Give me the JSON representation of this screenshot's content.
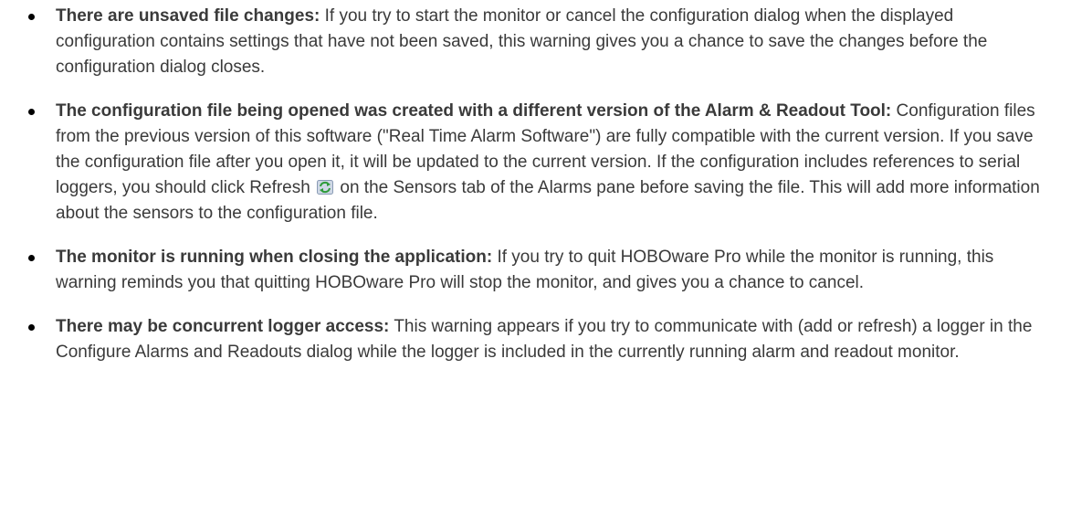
{
  "items": [
    {
      "term": "There are unsaved file changes:",
      "text": "If you try to start the monitor or cancel the configuration dialog when the displayed configuration contains settings that have not been saved, this warning gives you a chance to save the changes before the configuration dialog closes."
    },
    {
      "term": "The configuration file being opened was created with a different version of the Alarm & Readout Tool:",
      "text_before_icon": "Configuration files from the previous version of this software (\"Real Time Alarm Software\") are fully compatible with the current version. If you save the configuration file after you open it, it will be updated to the current version. If the configuration includes references to serial loggers, you should click Refresh",
      "icon": "refresh-icon",
      "text_after_icon": "on the Sensors tab of the Alarms pane before saving the file. This will add more information about the sensors to the configuration file."
    },
    {
      "term": "The monitor is running when closing the application:",
      "text": "If you try to quit HOBOware Pro while the monitor is running, this warning reminds you that quitting HOBOware Pro will stop the monitor, and gives you a chance to cancel."
    },
    {
      "term": "There may be concurrent logger access:",
      "text": "This warning appears if you try to communicate with (add or refresh) a logger in the Configure Alarms and Readouts dialog while the logger is included in the currently running alarm and readout monitor."
    }
  ]
}
